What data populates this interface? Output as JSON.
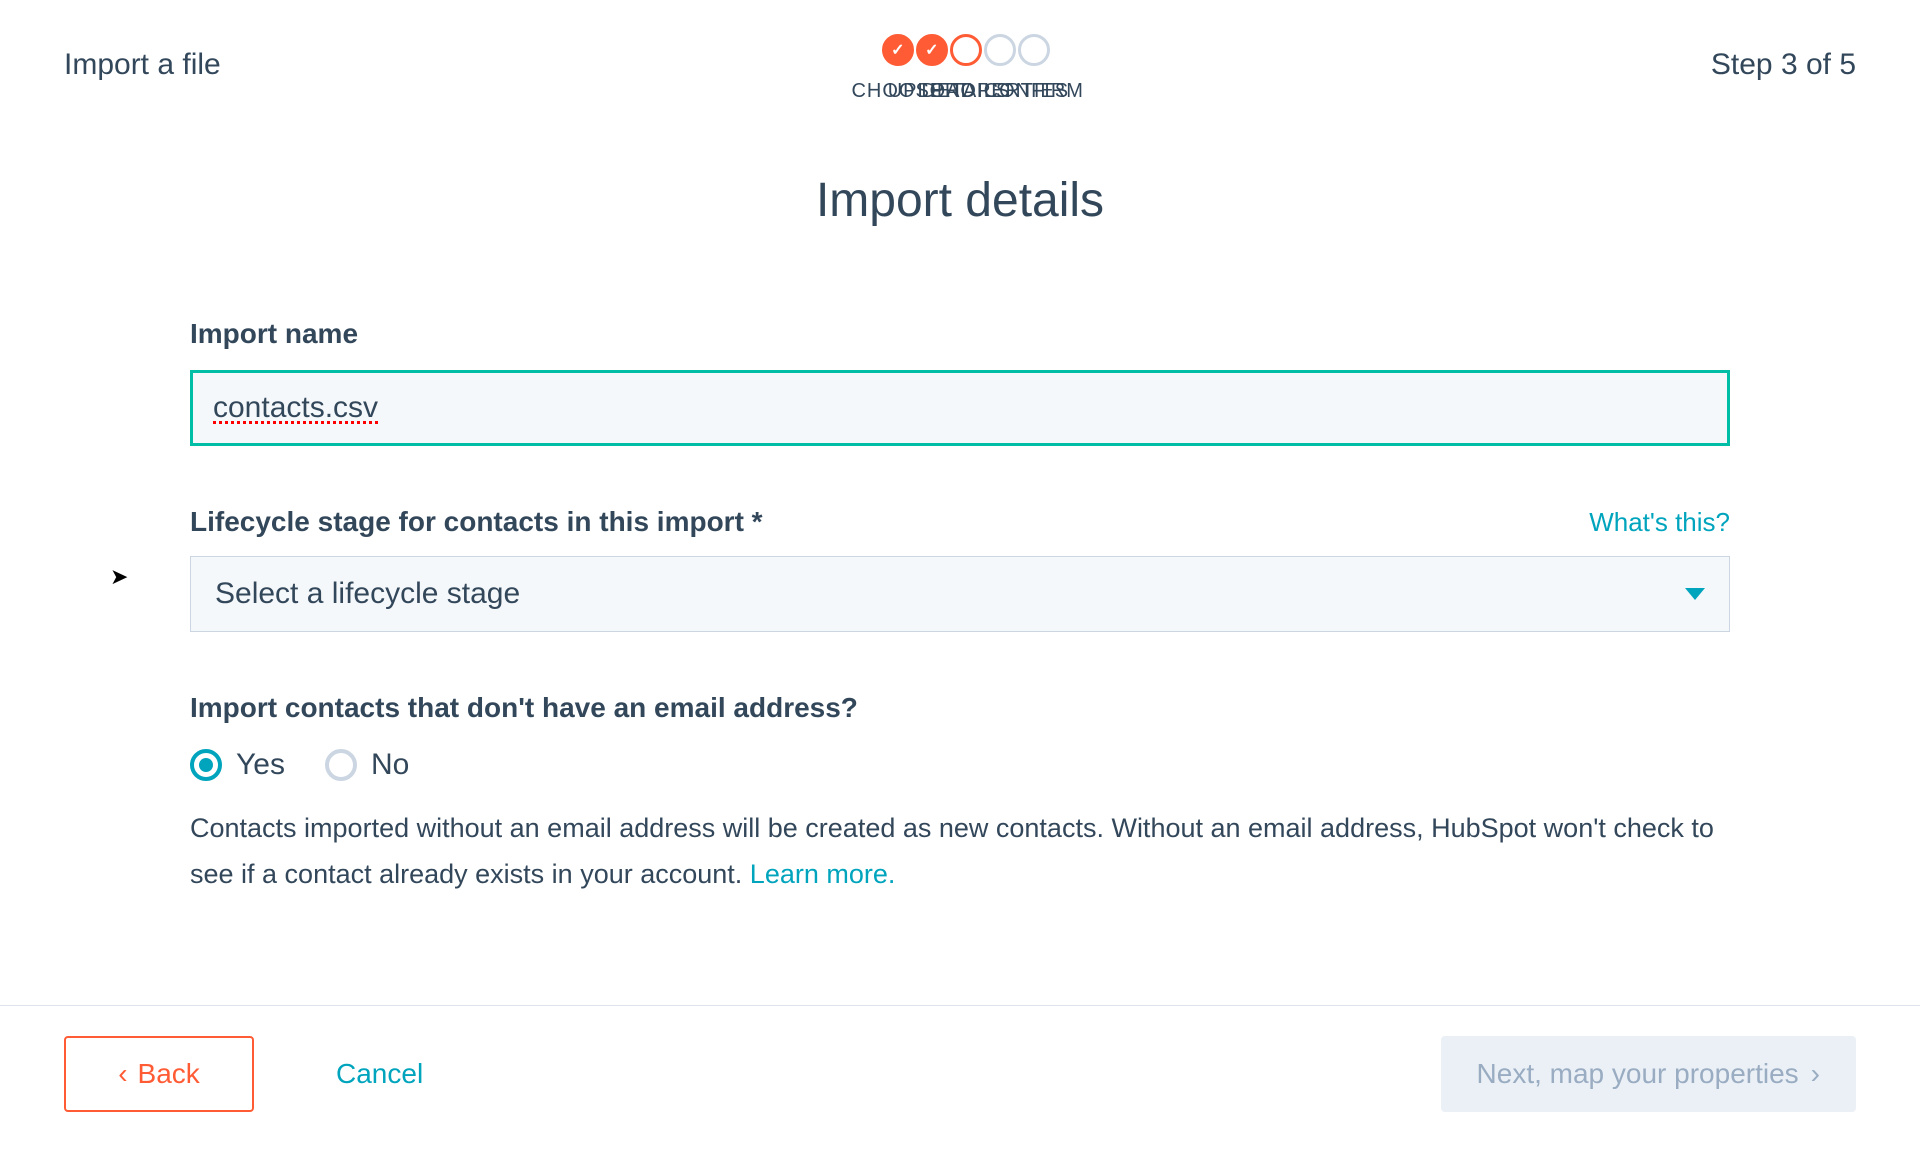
{
  "header": {
    "title": "Import a file",
    "step_indicator": "Step 3 of 5"
  },
  "stepper": {
    "steps": [
      {
        "label": "CHOOSE",
        "state": "done"
      },
      {
        "label": "UPLOAD",
        "state": "done"
      },
      {
        "label": "DETAILS",
        "state": "current"
      },
      {
        "label": "PROPERTIES",
        "state": "upcoming"
      },
      {
        "label": "CONFIRM",
        "state": "upcoming"
      }
    ]
  },
  "main": {
    "heading": "Import details",
    "import_name": {
      "label": "Import name",
      "value": "contacts.csv"
    },
    "lifecycle": {
      "label": "Lifecycle stage for contacts in this import *",
      "help_link": "What's this?",
      "placeholder": "Select a lifecycle stage"
    },
    "no_email": {
      "label": "Import contacts that don't have an email address?",
      "options": {
        "yes": "Yes",
        "no": "No"
      },
      "selected": "yes",
      "hint_text": "Contacts imported without an email address will be created as new contacts. Without an email address, HubSpot won't check to see if a contact already exists in your account. ",
      "learn_more": "Learn more."
    }
  },
  "footer": {
    "back": "Back",
    "cancel": "Cancel",
    "next": "Next, map your properties"
  }
}
